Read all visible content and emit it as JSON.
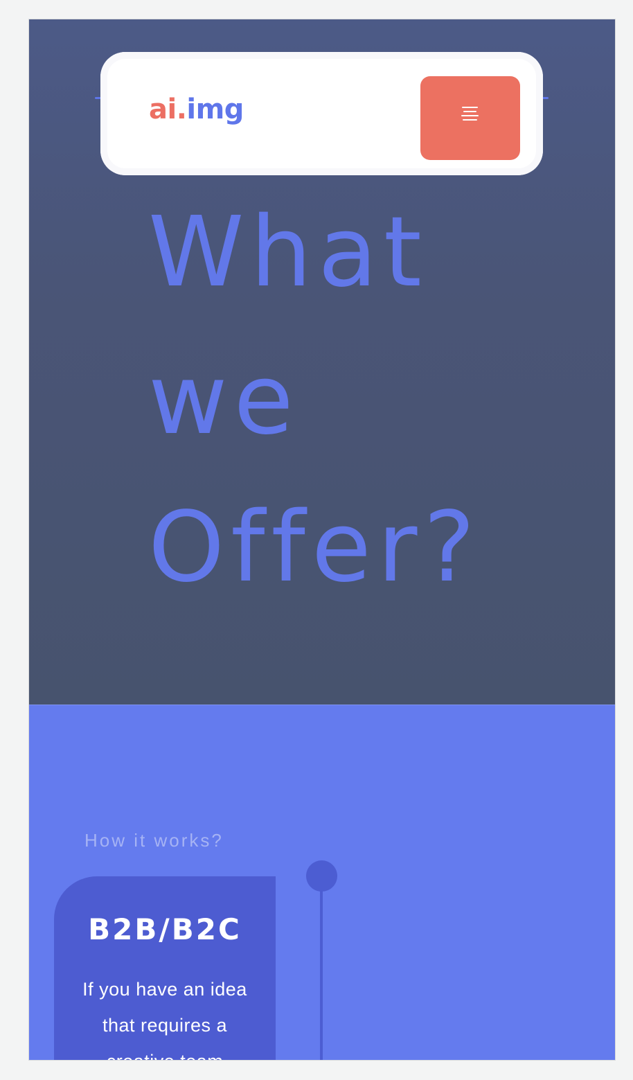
{
  "header": {
    "logo_part1": "ai.",
    "logo_part2": "img",
    "menu_icon": "hamburger-menu-icon"
  },
  "hero": {
    "title_lines": [
      "What",
      "we",
      "Offer?"
    ]
  },
  "how_it_works": {
    "label": "How it works?",
    "cards": [
      {
        "title": "B2B/B2C",
        "text": "If you have an idea that requires a creative team"
      }
    ]
  },
  "colors": {
    "hero_bg": "#4a5577",
    "accent_blue": "#6278e9",
    "menu_button": "#ec7161",
    "section_bg": "#647bee",
    "card_bg": "#4d5cd1",
    "logo_red": "#ec6f63"
  }
}
